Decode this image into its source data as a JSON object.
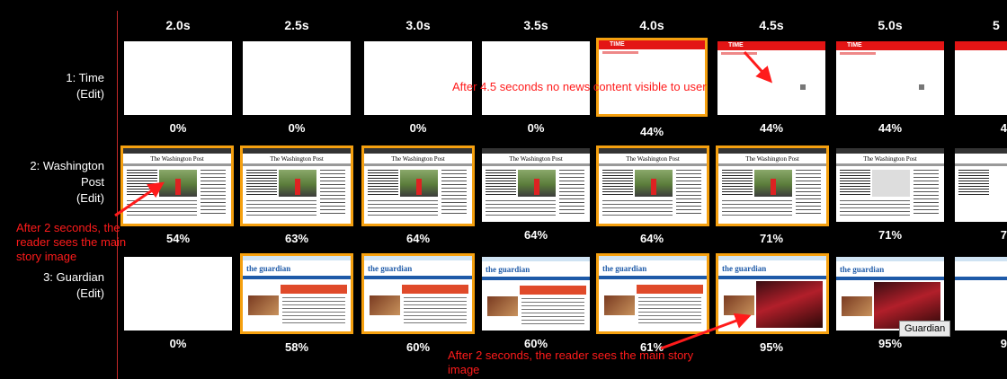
{
  "times": [
    "2.0s",
    "2.5s",
    "3.0s",
    "3.5s",
    "4.0s",
    "4.5s",
    "5.0s",
    "5"
  ],
  "rows": [
    {
      "name": "1: Time",
      "edit": "(Edit)",
      "percents": [
        "0%",
        "0%",
        "0%",
        "0%",
        "44%",
        "44%",
        "44%",
        "4"
      ]
    },
    {
      "name": "2: Washington Post",
      "edit": "(Edit)",
      "percents": [
        "54%",
        "63%",
        "64%",
        "64%",
        "64%",
        "71%",
        "71%",
        "7"
      ]
    },
    {
      "name": "3: Guardian",
      "edit": "(Edit)",
      "percents": [
        "0%",
        "58%",
        "60%",
        "60%",
        "61%",
        "95%",
        "95%",
        "9"
      ]
    }
  ],
  "thumb_text": {
    "time_logo": "TIME",
    "wapo_masthead": "The Washington Post",
    "guardian_logo": "the guardian"
  },
  "annotations": {
    "time": "After 4.5 seconds no news content visible to user",
    "wapo": "After 2 seconds, the reader sees the main story image",
    "guardian": "After 2 seconds, the reader sees the main story image"
  },
  "tooltip": "Guardian",
  "colors": {
    "background": "#000000",
    "highlight_border": "#f5a00f",
    "annotation": "#ff1b1b",
    "divider": "#c62828"
  }
}
